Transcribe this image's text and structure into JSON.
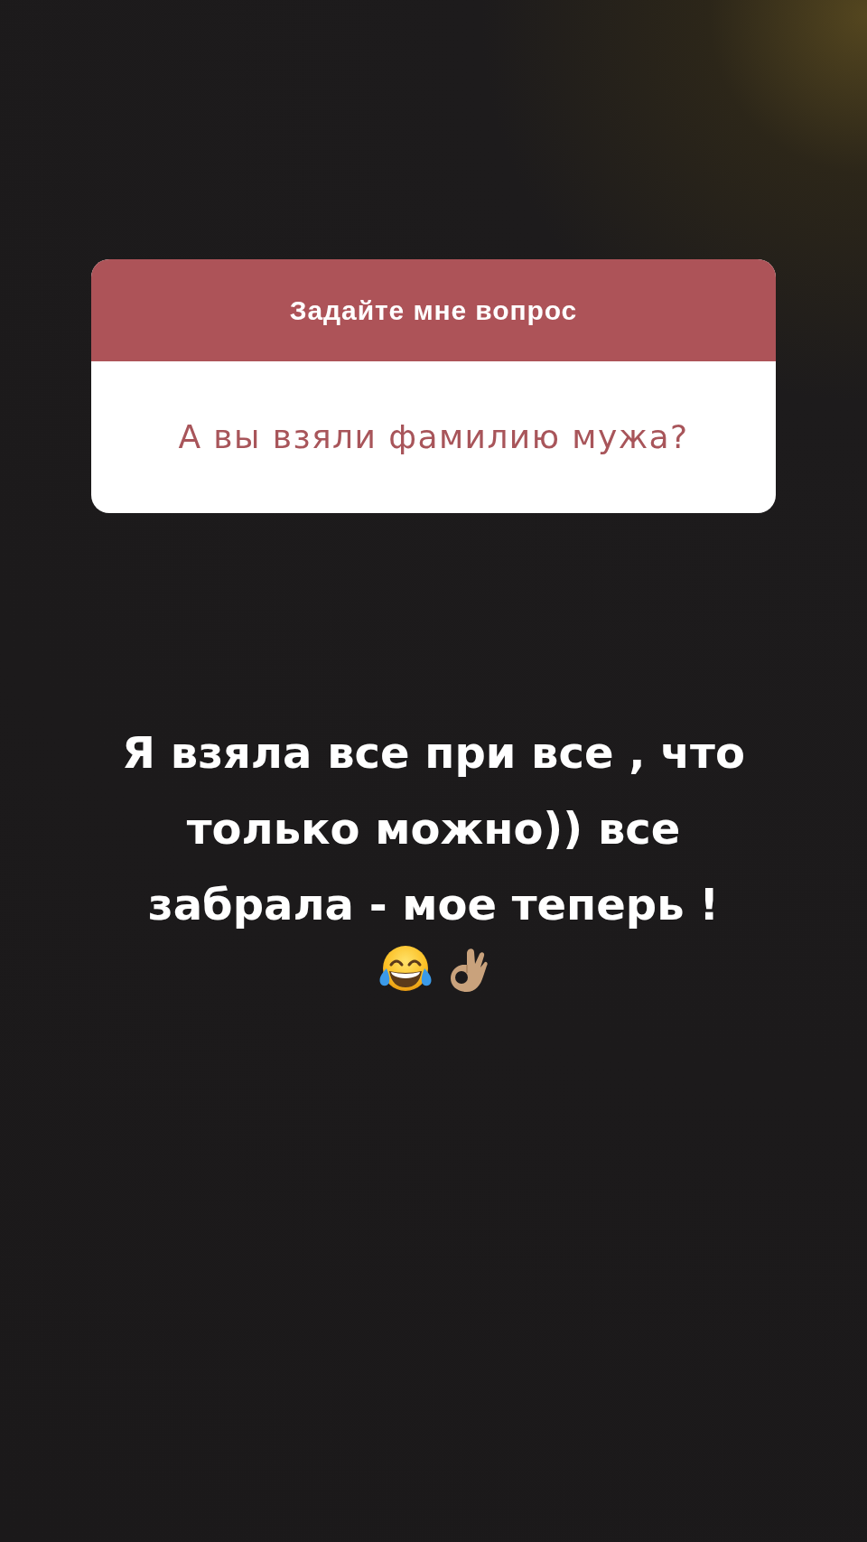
{
  "question_card": {
    "title": "Задайте мне вопрос",
    "question": "А вы взяли фамилию мужа?"
  },
  "answer": {
    "text": "Я взяла все при все , что только можно)) все забрала - мое теперь !"
  }
}
